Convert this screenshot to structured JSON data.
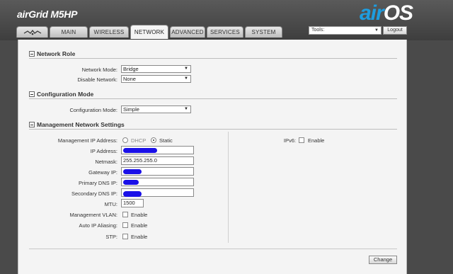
{
  "header": {
    "brand_prefix": "airGrid",
    "brand_model": "M5HP",
    "os_air": "air",
    "os_os": "OS"
  },
  "tabs": [
    {
      "label": "",
      "icon": "ubnt-logo-icon"
    },
    {
      "label": "MAIN"
    },
    {
      "label": "WIRELESS"
    },
    {
      "label": "NETWORK",
      "active": true
    },
    {
      "label": "ADVANCED"
    },
    {
      "label": "SERVICES"
    },
    {
      "label": "SYSTEM"
    }
  ],
  "tools": {
    "selected": "Tools:",
    "logout_label": "Logout"
  },
  "sections": {
    "network_role": {
      "title": "Network Role",
      "network_mode_label": "Network Mode:",
      "network_mode_value": "Bridge",
      "disable_network_label": "Disable Network:",
      "disable_network_value": "None"
    },
    "configuration_mode": {
      "title": "Configuration Mode",
      "config_mode_label": "Configuration Mode:",
      "config_mode_value": "Simple"
    },
    "management": {
      "title": "Management Network Settings",
      "mgmt_ip_label": "Management IP Address:",
      "dhcp_label": "DHCP",
      "static_label": "Static",
      "ip_label": "IP Address:",
      "netmask_label": "Netmask:",
      "netmask_value": "255.255.255.0",
      "gateway_label": "Gateway IP:",
      "primary_dns_label": "Primary DNS IP:",
      "secondary_dns_label": "Secondary DNS IP:",
      "mtu_label": "MTU:",
      "mtu_value": "1500",
      "mgmt_vlan_label": "Management VLAN:",
      "auto_ip_label": "Auto IP Aliasing:",
      "stp_label": "STP:",
      "enable_label": "Enable",
      "ipv6_label": "IPv6:",
      "ipv6_enable_label": "Enable"
    }
  },
  "change_label": "Change",
  "colors": {
    "redaction": "#1a10e8",
    "air_blue": "#1e9de0"
  }
}
